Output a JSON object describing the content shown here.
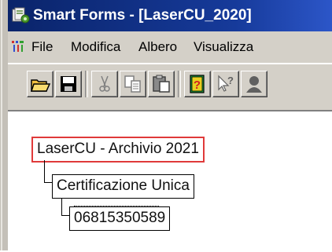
{
  "window": {
    "title": "Smart Forms - [LaserCU_2020]"
  },
  "menu": {
    "items": [
      {
        "label": "File"
      },
      {
        "label": "Modifica"
      },
      {
        "label": "Albero"
      },
      {
        "label": "Visualizza"
      }
    ]
  },
  "toolbar": {
    "buttons": [
      {
        "icon": "open-folder-icon"
      },
      {
        "icon": "save-disk-icon"
      },
      {
        "icon": "cut-scissors-icon"
      },
      {
        "icon": "copy-icon"
      },
      {
        "icon": "paste-icon"
      },
      {
        "icon": "help-book-icon"
      },
      {
        "icon": "context-help-icon"
      },
      {
        "icon": "user-icon"
      }
    ]
  },
  "tree": {
    "root": {
      "label": "LaserCU - Archivio 2021",
      "selected": true
    },
    "child": {
      "label": "Certificazione Unica"
    },
    "leaf": {
      "label": "06815350589"
    }
  },
  "colors": {
    "titlebar": "#0a246a",
    "selection_border": "#e03a3a",
    "chrome": "#d4d0c8"
  }
}
